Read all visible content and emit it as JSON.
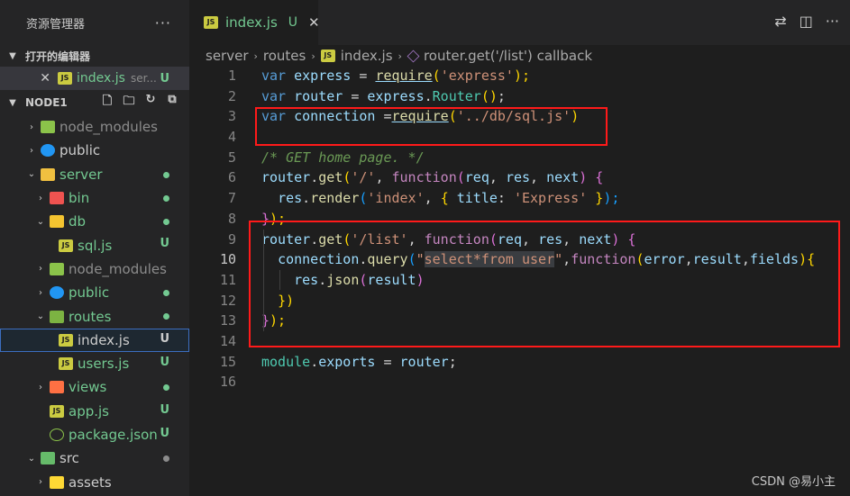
{
  "sidebar": {
    "title": "资源管理器",
    "more": "···",
    "open_editors": {
      "label": "打开的编辑器",
      "file": "index.js",
      "desc": "ser...",
      "status": "U"
    },
    "workspace": {
      "label": "NODE1"
    },
    "tree": [
      {
        "label": "node_modules",
        "status": ""
      },
      {
        "label": "public",
        "status": ""
      },
      {
        "label": "server",
        "status": ""
      },
      {
        "label": "bin",
        "status": ""
      },
      {
        "label": "db",
        "status": ""
      },
      {
        "label": "sql.js",
        "status": "U"
      },
      {
        "label": "node_modules",
        "status": ""
      },
      {
        "label": "public",
        "status": ""
      },
      {
        "label": "routes",
        "status": ""
      },
      {
        "label": "index.js",
        "status": "U"
      },
      {
        "label": "users.js",
        "status": "U"
      },
      {
        "label": "views",
        "status": ""
      },
      {
        "label": "app.js",
        "status": "U"
      },
      {
        "label": "package.json",
        "status": "U"
      },
      {
        "label": "src",
        "status": ""
      },
      {
        "label": "assets",
        "status": ""
      }
    ]
  },
  "editor": {
    "tab": {
      "label": "index.js",
      "status": "U"
    },
    "breadcrumb": [
      "server",
      "routes",
      "index.js",
      "router.get('/list') callback"
    ],
    "active_line": 10,
    "line_numbers": [
      "1",
      "2",
      "3",
      "4",
      "5",
      "6",
      "7",
      "8",
      "9",
      "10",
      "11",
      "12",
      "13",
      "14",
      "15",
      "16"
    ],
    "code": {
      "l1": [
        "var",
        " ",
        "express",
        " = ",
        "require",
        "(",
        "'express'",
        ");"
      ],
      "l2": [
        "var",
        " ",
        "router",
        " = ",
        "express",
        ".",
        "Router",
        "()",
        ";"
      ],
      "l3": [
        "var",
        " ",
        "connection",
        " =",
        "require",
        "(",
        "'../db/sql.js'",
        ")"
      ],
      "l5": [
        "/* GET home page. */"
      ],
      "l6": [
        "router",
        ".",
        "get",
        "(",
        "'/'",
        ", ",
        "function",
        "(",
        "req",
        ", ",
        "res",
        ", ",
        "next",
        ") ",
        "{"
      ],
      "l7": [
        "  ",
        "res",
        ".",
        "render",
        "(",
        "'index'",
        ", ",
        "{",
        " ",
        "title",
        ": ",
        "'Express'",
        " ",
        "}",
        ");"
      ],
      "l8": [
        "}",
        ");"
      ],
      "l9": [
        "router",
        ".",
        "get",
        "(",
        "'/list'",
        ", ",
        "function",
        "(",
        "req",
        ", ",
        "res",
        ", ",
        "next",
        ") ",
        "{"
      ],
      "l10": [
        "  ",
        "connection",
        ".",
        "query",
        "(",
        "\"",
        "select*from user",
        "\"",
        ",",
        "function",
        "(",
        "error",
        ",",
        "result",
        ",",
        "fields",
        ")",
        "{"
      ],
      "l11": [
        "    ",
        "res",
        ".",
        "json",
        "(",
        "result",
        ")"
      ],
      "l12": [
        "  ",
        "})"
      ],
      "l13": [
        "}",
        ");"
      ],
      "l15": [
        "module",
        ".",
        "exports",
        " = ",
        "router",
        ";"
      ]
    }
  },
  "watermark": "CSDN @易小主"
}
